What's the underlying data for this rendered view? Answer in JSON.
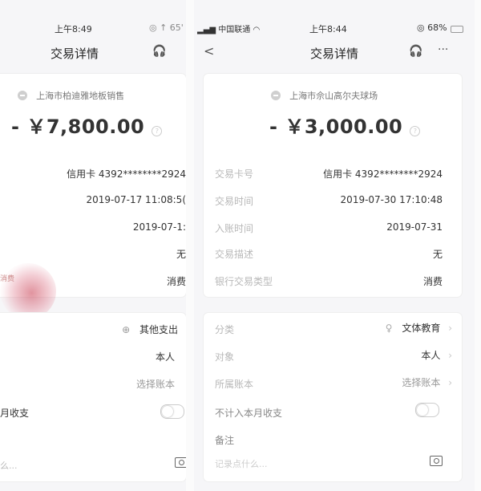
{
  "left": {
    "status_time": "上午8:49",
    "status_right": "◎ ↑ 65'",
    "nav_title": "交易详情",
    "merchant": "上海市柏迪雅地板销售",
    "amount": "- ￥7,800.00",
    "rows": [
      {
        "value": "信用卡 4392********2924"
      },
      {
        "value": "2019-07-17 11:08:5("
      },
      {
        "value": "2019-07-1:"
      },
      {
        "value": "无"
      },
      {
        "value": "消费"
      }
    ],
    "thumb_text": "消费",
    "category_value": "其他支出",
    "target_value": "本人",
    "ledger_value": "选择账本",
    "toggle_label": "月收支",
    "note_placeholder": "么..."
  },
  "right": {
    "status_carrier": "中国联通",
    "status_time": "上午8:44",
    "status_battery": "◎ 68%",
    "nav_back": "<",
    "nav_title": "交易详情",
    "nav_more": "···",
    "merchant": "上海市佘山高尔夫球场",
    "amount": "- ￥3,000.00",
    "rows": [
      {
        "label": "交易卡号",
        "value": "信用卡 4392********2924"
      },
      {
        "label": "交易时间",
        "value": "2019-07-30 17:10:48"
      },
      {
        "label": "入账时间",
        "value": "2019-07-31"
      },
      {
        "label": "交易描述",
        "value": "无"
      },
      {
        "label": "银行交易类型",
        "value": "消费"
      }
    ],
    "settings": [
      {
        "label": "分类",
        "value": "文体教育"
      },
      {
        "label": "对象",
        "value": "本人"
      },
      {
        "label": "所属账本",
        "value": "选择账本"
      }
    ],
    "toggle_label": "不计入本月收支",
    "note_label": "备注",
    "note_placeholder": "记录点什么..."
  }
}
